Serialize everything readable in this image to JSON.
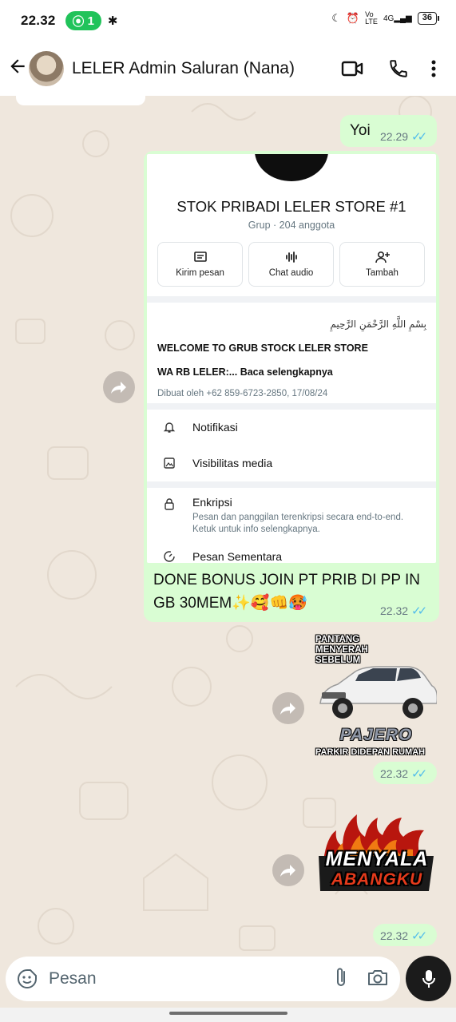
{
  "status_bar": {
    "time": "22.32",
    "hotspot_count": "1",
    "battery": "36",
    "network": "4G"
  },
  "header": {
    "title": "LELER Admin Saluran (Nana)"
  },
  "messages": [
    {
      "type": "text",
      "text": "Yoi",
      "time": "22.29"
    },
    {
      "type": "image_caption",
      "screenshot": {
        "group_name": "STOK PRIBADI LELER STORE #1",
        "group_subtitle": "Grup · 204 anggota",
        "actions": [
          "Kirim pesan",
          "Chat audio",
          "Tambah"
        ],
        "bismillah": "بِسْمِ اللَّهِ الرَّحْمَنِ الرَّحِيمِ",
        "welcome": "WELCOME TO GRUB STOCK LELER STORE",
        "description": "WA RB LELER:... Baca selengkapnya",
        "created_by": "Dibuat oleh +62 859-6723-2850, 17/08/24",
        "settings": [
          {
            "label": "Notifikasi"
          },
          {
            "label": "Visibilitas media"
          },
          {
            "label": "Enkripsi",
            "sub": "Pesan dan panggilan terenkripsi secara end-to-end. Ketuk untuk info selengkapnya."
          },
          {
            "label": "Pesan Sementara"
          }
        ]
      },
      "caption": "DONE BONUS JOIN PT PRIB DI PP IN GB 30MEM✨🥰👊🥵",
      "time": "22.32"
    },
    {
      "type": "sticker",
      "top_text": "PANTANG MENYERAH SEBELUM",
      "brand_text": "PAJERO",
      "bottom_text": "PARKIR DIDEPAN RUMAH",
      "time": "22.32"
    },
    {
      "type": "sticker",
      "text_line1": "MENYALA",
      "text_line2": "ABANGKU",
      "time": "22.32"
    }
  ],
  "input": {
    "placeholder": "Pesan"
  },
  "colors": {
    "outgoing_bubble": "#d9fdd3",
    "wallpaper": "#efe7dd",
    "read_ticks": "#53bdeb",
    "mic_button": "#1b1b1b"
  }
}
